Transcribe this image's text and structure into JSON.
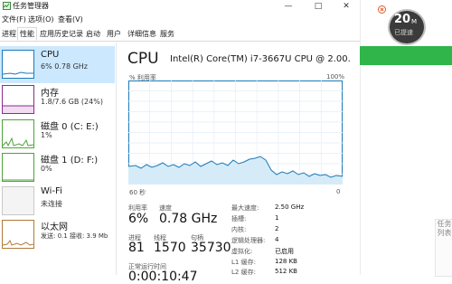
{
  "window": {
    "title": "任务管理器",
    "controls": {
      "minimize": "—",
      "maximize": "□",
      "close": "✕"
    }
  },
  "menu": [
    "文件(F)",
    "选项(O)",
    "查看(V)"
  ],
  "tabs": [
    "进程",
    "性能",
    "应用历史记录",
    "启动",
    "用户",
    "详细信息",
    "服务"
  ],
  "active_tab": "性能",
  "sidebar": {
    "items": [
      {
        "name": "CPU",
        "value": "6% 0.78 GHz",
        "color": "#1c7ab8"
      },
      {
        "name": "内存",
        "value": "1.8/7.6 GB (24%)",
        "color": "#8b2d8b"
      },
      {
        "name": "磁盘 0 (C: E:)",
        "value": "1%",
        "color": "#4da33a"
      },
      {
        "name": "磁盘 1 (D: F:)",
        "value": "0%",
        "color": "#4da33a"
      },
      {
        "name": "Wi-Fi",
        "value": "未连接",
        "color": "#a0a0a0"
      },
      {
        "name": "以太网",
        "value": "发送: 0.1 接收: 3.9 Mb",
        "color": "#b0793a"
      }
    ]
  },
  "main": {
    "title": "CPU",
    "model": "Intel(R) Core(TM) i7-3667U CPU @ 2.00...",
    "graph": {
      "ylabel": "% 利用率",
      "ymax_label": "100%",
      "time_label": "60 秒",
      "zero_label": "0"
    },
    "stats": [
      {
        "label": "利用率",
        "value": "6%"
      },
      {
        "label": "速度",
        "value": "0.78 GHz"
      },
      {
        "label": "进程",
        "value": "81"
      },
      {
        "label": "线程",
        "value": "1570"
      },
      {
        "label": "句柄",
        "value": "35730"
      }
    ],
    "uptime_label": "正常运行时间",
    "uptime_value": "0:00:10:47",
    "specs": [
      {
        "label": "最大速度:",
        "value": "2.50 GHz"
      },
      {
        "label": "插槽:",
        "value": "1"
      },
      {
        "label": "内核:",
        "value": "2"
      },
      {
        "label": "逻辑处理器:",
        "value": "4"
      },
      {
        "label": "虚拟化:",
        "value": "已启用"
      },
      {
        "label": "L1 缓存:",
        "value": "128 KB"
      },
      {
        "label": "L2 缓存:",
        "value": "512 KB"
      }
    ]
  },
  "right_panel": {
    "badge_number": "20",
    "badge_unit": "M",
    "badge_sub": "已提速",
    "side_tab": "任务列表",
    "accent": "#2fb54a"
  },
  "colors": {
    "cpu_line": "#1c7ab8",
    "cpu_fill": "#d6ebf8",
    "selected": "#cce8ff"
  }
}
